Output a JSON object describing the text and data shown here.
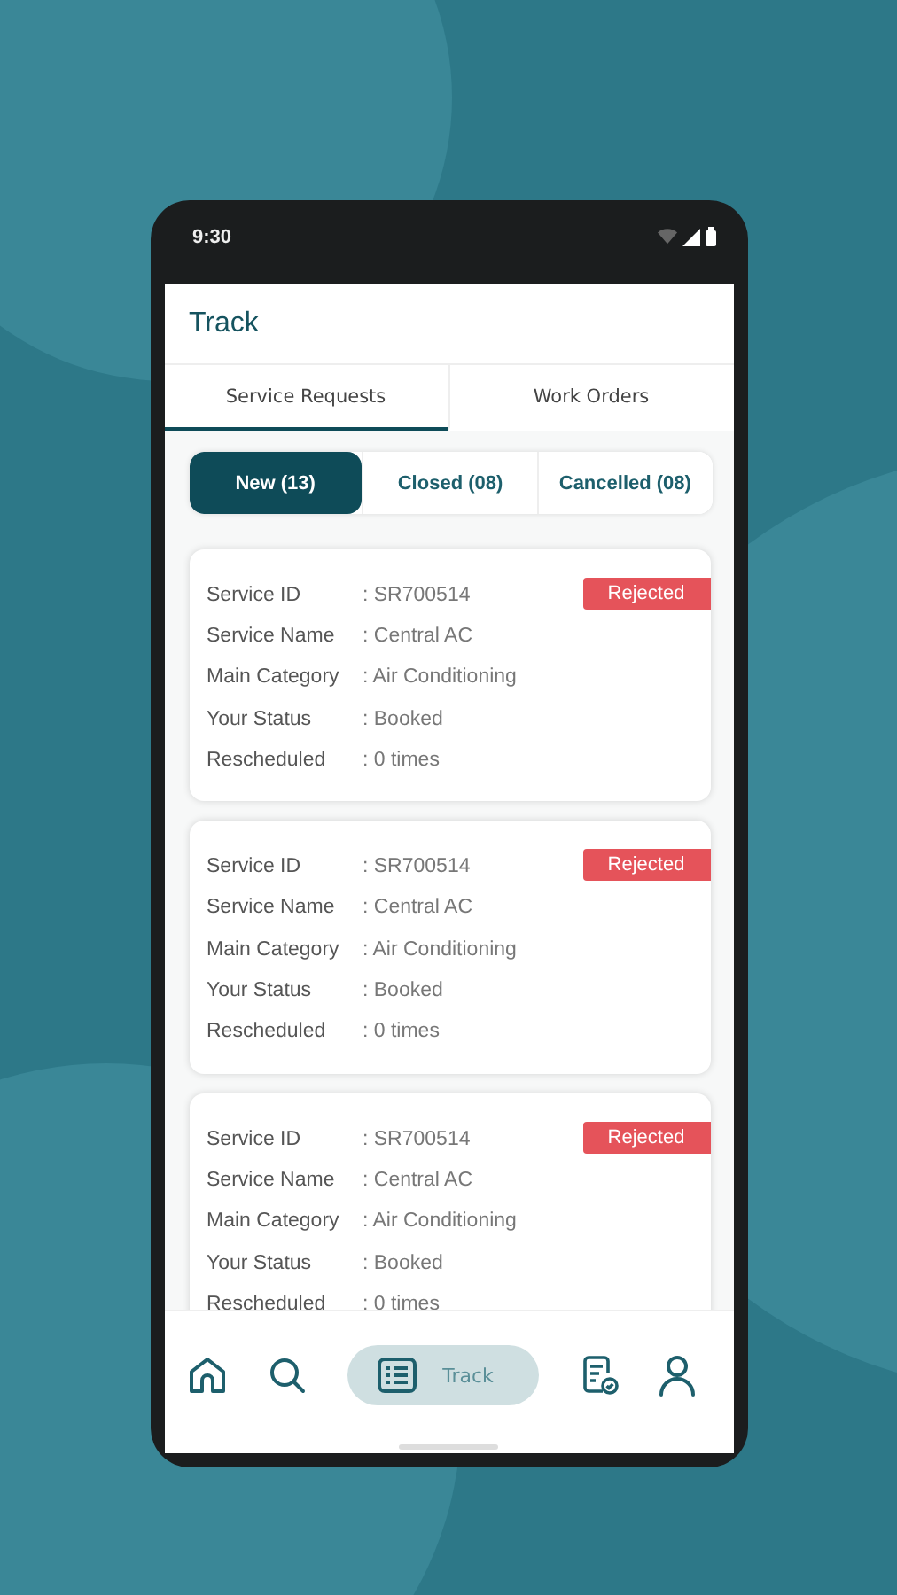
{
  "status_bar": {
    "time": "9:30"
  },
  "header": {
    "title": "Track"
  },
  "tabs": [
    {
      "label": "Service Requests",
      "selected": true
    },
    {
      "label": "Work Orders",
      "selected": false
    }
  ],
  "filters": [
    {
      "label": "New (13)",
      "selected": true
    },
    {
      "label": "Closed (08)",
      "selected": false
    },
    {
      "label": "Cancelled (08)",
      "selected": false
    }
  ],
  "requests": [
    {
      "status": "Rejected",
      "fields": [
        {
          "label": "Service ID",
          "value": ": SR700514"
        },
        {
          "label": "Service Name",
          "value": ": Central AC"
        },
        {
          "label": "Main Category",
          "value": ": Air Conditioning"
        },
        {
          "label": "Your Status",
          "value": ": Booked"
        },
        {
          "label": "Rescheduled",
          "value": ": 0 times"
        }
      ]
    },
    {
      "status": "Rejected",
      "fields": [
        {
          "label": "Service ID",
          "value": ": SR700514"
        },
        {
          "label": "Service Name",
          "value": ": Central AC"
        },
        {
          "label": "Main Category",
          "value": ": Air Conditioning"
        },
        {
          "label": "Your Status",
          "value": ": Booked"
        },
        {
          "label": "Rescheduled",
          "value": ": 0 times"
        }
      ]
    },
    {
      "status": "Rejected",
      "fields": [
        {
          "label": "Service ID",
          "value": ": SR700514"
        },
        {
          "label": "Service Name",
          "value": ": Central AC"
        },
        {
          "label": "Main Category",
          "value": ": Air Conditioning"
        },
        {
          "label": "Your Status",
          "value": ": Booked"
        },
        {
          "label": "Rescheduled",
          "value": ": 0 times"
        }
      ]
    }
  ],
  "bottom_nav": [
    {
      "selected": false
    },
    {
      "selected": false
    },
    {
      "label": "Track",
      "selected": true
    },
    {
      "selected": false
    },
    {
      "selected": false
    }
  ]
}
